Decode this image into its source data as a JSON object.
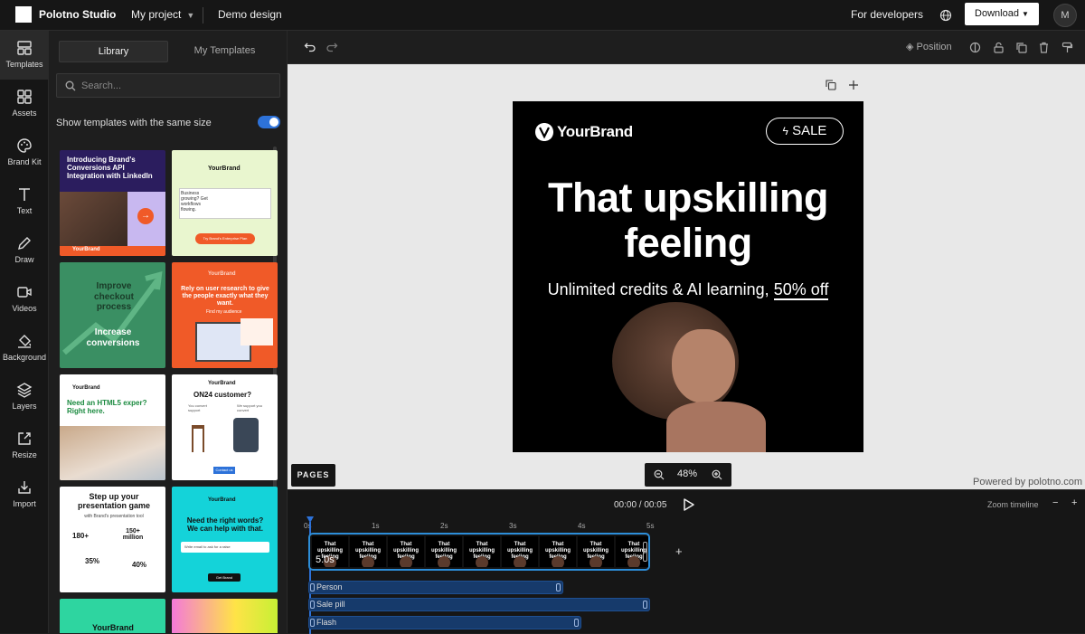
{
  "app": {
    "title": "Polotno Studio",
    "project": "My project",
    "design_name": "Demo design"
  },
  "header": {
    "for_developers": "For developers",
    "download": "Download",
    "avatar_initial": "M"
  },
  "rail": [
    {
      "label": "Templates",
      "icon": "templates-icon"
    },
    {
      "label": "Assets",
      "icon": "assets-icon"
    },
    {
      "label": "Brand Kit",
      "icon": "palette-icon"
    },
    {
      "label": "Text",
      "icon": "text-icon"
    },
    {
      "label": "Draw",
      "icon": "pencil-icon"
    },
    {
      "label": "Videos",
      "icon": "video-icon"
    },
    {
      "label": "Background",
      "icon": "paint-bucket-icon"
    },
    {
      "label": "Layers",
      "icon": "layers-icon"
    },
    {
      "label": "Resize",
      "icon": "resize-icon"
    },
    {
      "label": "Import",
      "icon": "import-icon"
    }
  ],
  "panel": {
    "tabs": [
      "Library",
      "My Templates"
    ],
    "search_placeholder": "Search...",
    "same_size_label": "Show templates with the same size",
    "same_size_enabled": true
  },
  "templates": [
    {
      "title": "Introducing Brand's Conversions API Integration with LinkedIn",
      "brand": "YourBrand"
    },
    {
      "brand": "YourBrand",
      "body": "Business growing? Get workflows flowing.",
      "cta": "Try Brand's Enterprise Plan"
    },
    {
      "title": "Improve checkout process",
      "subtitle": "Increase conversions"
    },
    {
      "brand": "YourBrand",
      "title": "Rely on user research to give the people exactly what they want.",
      "link": "Find my audience"
    },
    {
      "brand": "YourBrand",
      "title": "Need an HTML5 exper? Right here."
    },
    {
      "brand": "YourBrand",
      "title": "ON24 customer?",
      "left": "You convert support",
      "right": "We support you convert",
      "cta": "Contact us"
    },
    {
      "title": "Step up your presentation game",
      "subtitle": "with Brand's presentation tool",
      "stats": [
        "180+",
        "150+ million",
        "35%",
        "40%"
      ]
    },
    {
      "brand": "YourBrand",
      "title": "Need the right words? We can help with that.",
      "input": "Write email to ask for a raise",
      "cta": "Get Brand"
    },
    {
      "brand": "YourBrand"
    },
    {
      "brand": ""
    }
  ],
  "toolbar": {
    "position_label": "Position"
  },
  "canvas": {
    "brand": "YourBrand",
    "sale": "SALE",
    "headline": "That upskilling feeling",
    "subline": "Unlimited credits & AI learning,",
    "offer": "50% off"
  },
  "workspace": {
    "pages_label": "PAGES",
    "zoom": "48%",
    "powered_by": "Powered by polotno.com"
  },
  "timeline": {
    "time": "00:00 / 00:05",
    "zoom_label": "Zoom timeline",
    "ticks": [
      "0s",
      "1s",
      "2s",
      "3s",
      "4s",
      "5s"
    ],
    "clip_duration": "5.0s",
    "clip_thumb_text": "That upskilling feeling",
    "tracks": [
      {
        "name": "Person",
        "end_fraction": 0.745
      },
      {
        "name": "Sale pill",
        "end_fraction": 1.0
      },
      {
        "name": "Flash",
        "end_fraction": 0.8
      }
    ]
  },
  "colors": {
    "accent": "#2d72d9",
    "track_blue": "#163a6b",
    "canvas_bg": "#000000"
  }
}
